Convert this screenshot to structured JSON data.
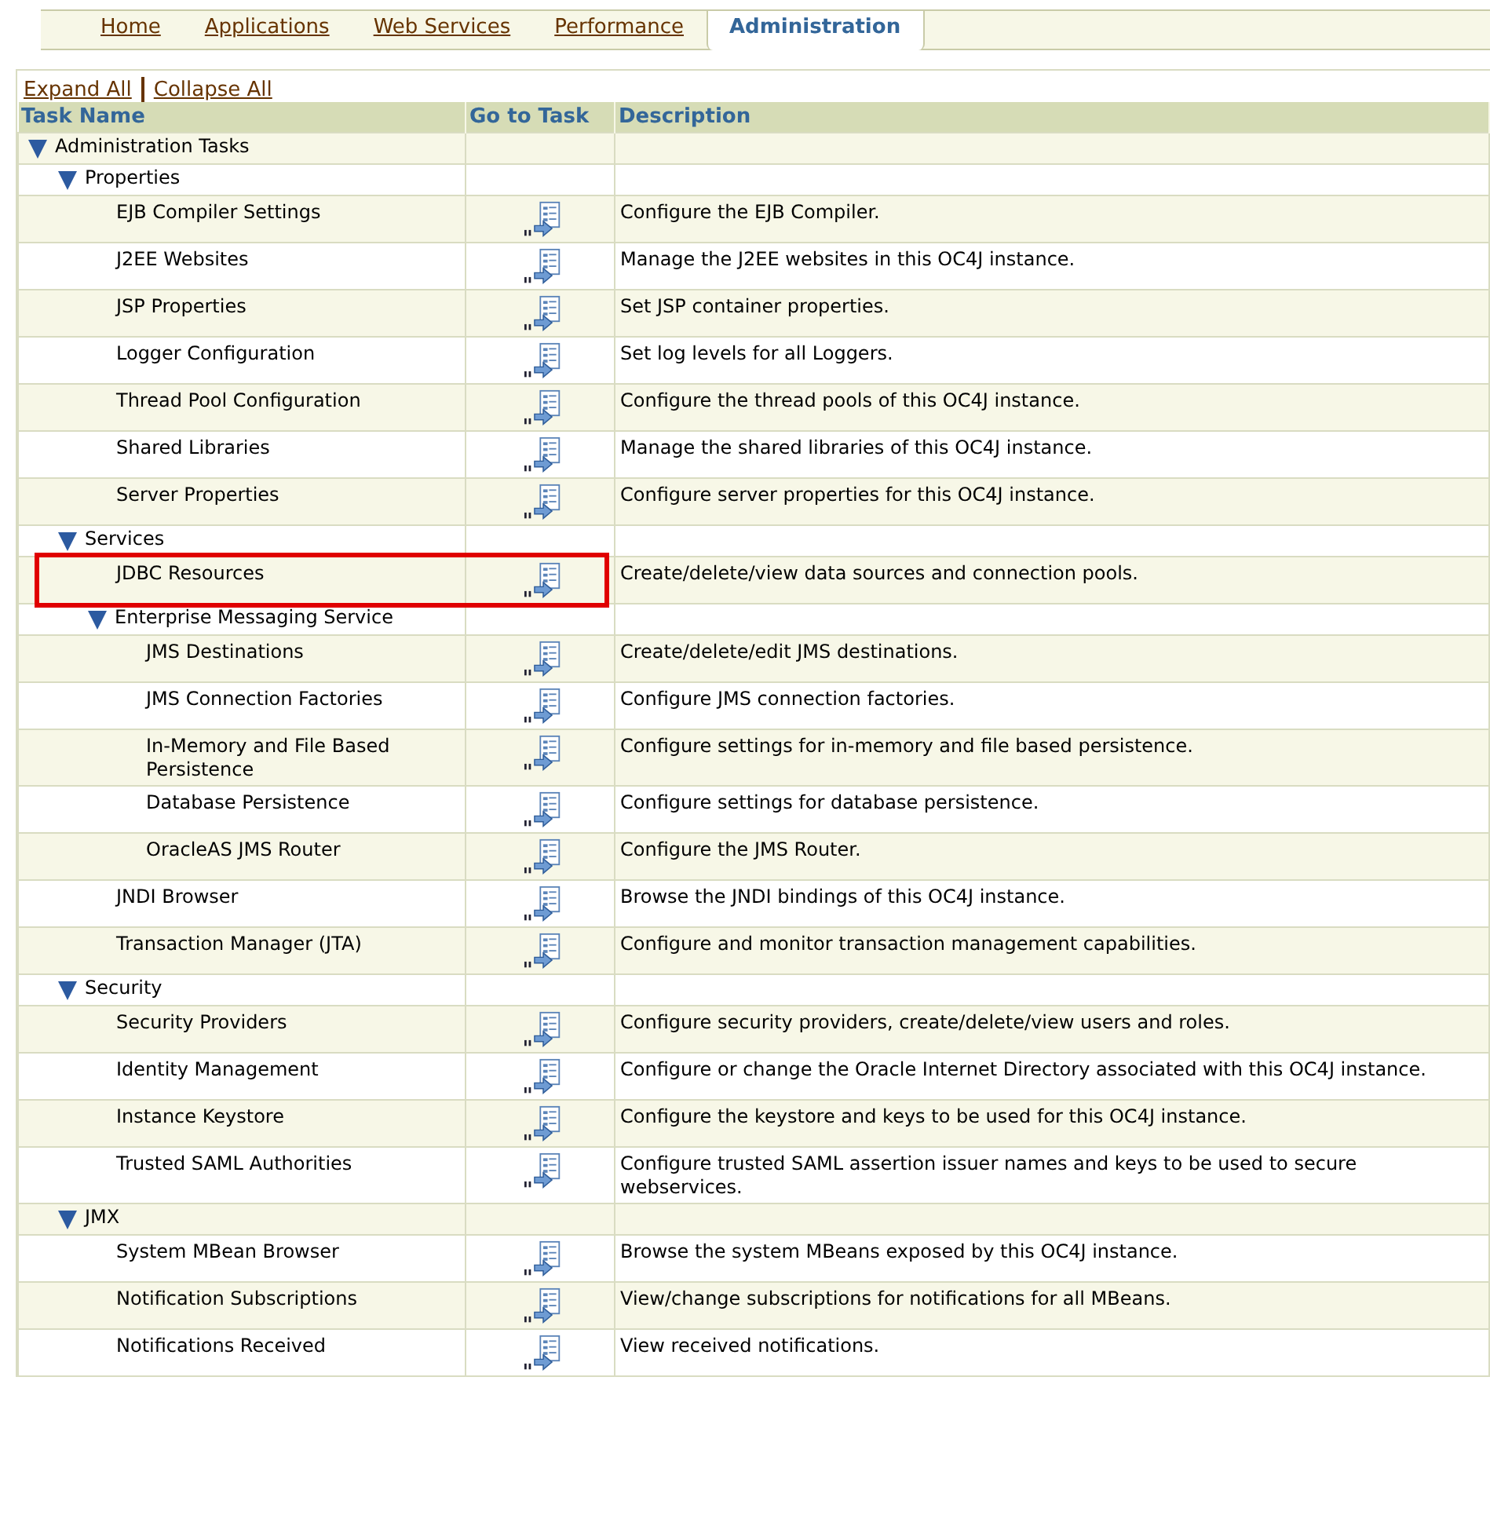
{
  "tabs": [
    {
      "label": "Home",
      "selected": false
    },
    {
      "label": "Applications",
      "selected": false
    },
    {
      "label": "Web Services",
      "selected": false
    },
    {
      "label": "Performance",
      "selected": false
    },
    {
      "label": "Administration",
      "selected": true
    }
  ],
  "tree_links": [
    "Expand All",
    "Collapse All"
  ],
  "columns": [
    "Task Name",
    "Go to Task",
    "Description"
  ],
  "tree": [
    {
      "label": "Administration Tasks",
      "expanded": true,
      "children": [
        {
          "label": "Properties",
          "expanded": true,
          "children": [
            {
              "name": "EJB Compiler Settings",
              "description": "Configure the EJB Compiler.",
              "highlighted": false
            },
            {
              "name": "J2EE Websites",
              "description": "Manage the J2EE websites in this OC4J instance.",
              "highlighted": false
            },
            {
              "name": "JSP Properties",
              "description": "Set JSP container properties.",
              "highlighted": false
            },
            {
              "name": "Logger Configuration",
              "description": "Set log levels for all Loggers.",
              "highlighted": false
            },
            {
              "name": "Thread Pool Configuration",
              "description": "Configure the thread pools of this OC4J instance.",
              "highlighted": false
            },
            {
              "name": "Shared Libraries",
              "description": "Manage the shared libraries of this OC4J instance.",
              "highlighted": false
            },
            {
              "name": "Server Properties",
              "description": "Configure server properties for this OC4J instance.",
              "highlighted": false
            }
          ]
        },
        {
          "label": "Services",
          "expanded": true,
          "children": [
            {
              "name": "JDBC Resources",
              "description": "Create/delete/view data sources and connection pools.",
              "highlighted": true
            },
            {
              "label": "Enterprise Messaging Service",
              "expanded": true,
              "children": [
                {
                  "name": "JMS Destinations",
                  "description": "Create/delete/edit JMS destinations.",
                  "highlighted": false
                },
                {
                  "name": "JMS Connection Factories",
                  "description": "Configure JMS connection factories.",
                  "highlighted": false
                },
                {
                  "name": "In-Memory and File Based Persistence",
                  "description": "Configure settings for in-memory and file based persistence.",
                  "highlighted": false
                },
                {
                  "name": "Database Persistence",
                  "description": "Configure settings for database persistence.",
                  "highlighted": false
                },
                {
                  "name": "OracleAS JMS Router",
                  "description": "Configure the JMS Router.",
                  "highlighted": false
                }
              ]
            },
            {
              "name": "JNDI Browser",
              "description": "Browse the JNDI bindings of this OC4J instance.",
              "highlighted": false
            },
            {
              "name": "Transaction Manager (JTA)",
              "description": "Configure and monitor transaction management capabilities.",
              "highlighted": false
            }
          ]
        },
        {
          "label": "Security",
          "expanded": true,
          "children": [
            {
              "name": "Security Providers",
              "description": "Configure security providers, create/delete/view users and roles.",
              "highlighted": false
            },
            {
              "name": "Identity Management",
              "description": "Configure or change the Oracle Internet Directory associated with this OC4J instance.",
              "highlighted": false
            },
            {
              "name": "Instance Keystore",
              "description": "Configure the keystore and keys to be used for this OC4J instance.",
              "highlighted": false
            },
            {
              "name": "Trusted SAML Authorities",
              "description": "Configure trusted SAML assertion issuer names and keys to be used to secure webservices.",
              "highlighted": false
            }
          ]
        },
        {
          "label": "JMX",
          "expanded": true,
          "children": [
            {
              "name": "System MBean Browser",
              "description": "Browse the system MBeans exposed by this OC4J instance.",
              "highlighted": false
            },
            {
              "name": "Notification Subscriptions",
              "description": "View/change subscriptions for notifications for all MBeans.",
              "highlighted": false
            },
            {
              "name": "Notifications Received",
              "description": "View received notifications.",
              "highlighted": false
            }
          ]
        }
      ]
    }
  ]
}
